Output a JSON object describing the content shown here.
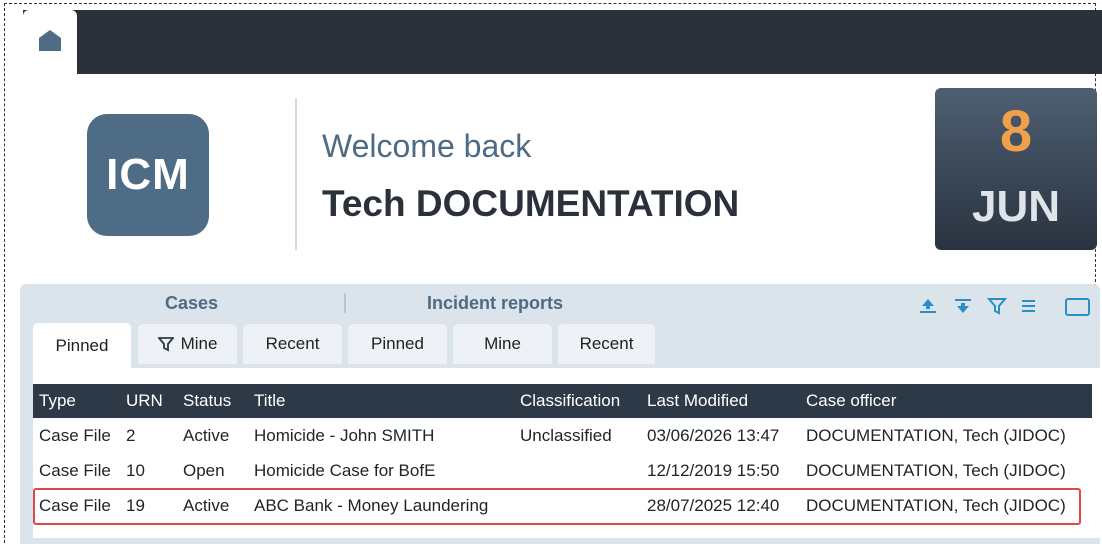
{
  "header": {
    "welcome": "Welcome back",
    "user_name": "Tech DOCUMENTATION",
    "logo_text": "ICM",
    "date_day": "8",
    "date_month": "JUN"
  },
  "groups": {
    "cases": "Cases",
    "incidents": "Incident reports"
  },
  "tabs": [
    {
      "label": "Pinned"
    },
    {
      "label": "Mine"
    },
    {
      "label": "Recent"
    },
    {
      "label": "Pinned"
    },
    {
      "label": "Mine"
    },
    {
      "label": "Recent"
    }
  ],
  "toolbar_icons": [
    "collapse-up-icon",
    "expand-down-icon",
    "filter-icon",
    "menu-icon",
    "maximize-icon"
  ],
  "table": {
    "columns": [
      "Type",
      "URN",
      "Status",
      "Title",
      "Classification",
      "Last Modified",
      "Case officer"
    ],
    "rows": [
      [
        "Case File",
        "2",
        "Active",
        "Homicide - John SMITH",
        "Unclassified",
        "03/06/2026 13:47",
        "DOCUMENTATION, Tech (JIDOC)"
      ],
      [
        "Case File",
        "10",
        "Open",
        "Homicide Case for BofE",
        "",
        "12/12/2019 15:50",
        "DOCUMENTATION, Tech (JIDOC)"
      ],
      [
        "Case File",
        "19",
        "Active",
        "ABC Bank - Money Laundering",
        "",
        "28/07/2025 12:40",
        "DOCUMENTATION, Tech (JIDOC)"
      ]
    ]
  },
  "colors": {
    "topbar": "#2b313a",
    "brand": "#4f6c86",
    "accent_date": "#f0a04a",
    "highlight": "#e04848",
    "icon_blue": "#2a8fc9"
  }
}
